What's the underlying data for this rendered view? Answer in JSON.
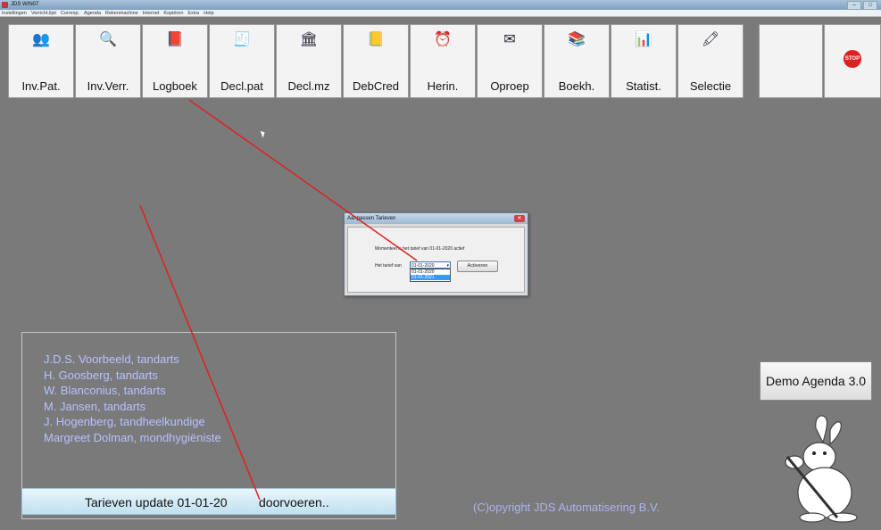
{
  "window": {
    "title": "JDS WIN07"
  },
  "menu": [
    "Instellingen",
    "Verricht.lijst",
    "Corresp.",
    "Agenda",
    "Rekenmachine",
    "Internet",
    "Kopiëren",
    "Extra",
    "Help"
  ],
  "toolbar": [
    {
      "label": "Inv.Pat.",
      "icon": "patients-icon",
      "glyph": "👥"
    },
    {
      "label": "Inv.Verr.",
      "icon": "search-icon",
      "glyph": "🔍"
    },
    {
      "label": "Logboek",
      "icon": "book-icon",
      "glyph": "📕"
    },
    {
      "label": "Decl.pat",
      "icon": "declaration-icon",
      "glyph": "🧾"
    },
    {
      "label": "Decl.mz",
      "icon": "building-icon",
      "glyph": "🏛"
    },
    {
      "label": "DebCred",
      "icon": "ledger-icon",
      "glyph": "📒"
    },
    {
      "label": "Herin.",
      "icon": "alarm-clock-icon",
      "glyph": "⏰"
    },
    {
      "label": "Oproep",
      "icon": "envelope-icon",
      "glyph": "✉"
    },
    {
      "label": "Boekh.",
      "icon": "books-icon",
      "glyph": "📚"
    },
    {
      "label": "Statist.",
      "icon": "bar-chart-icon",
      "glyph": "📊"
    },
    {
      "label": "Selectie",
      "icon": "selection-icon",
      "glyph": "🖍"
    }
  ],
  "stop": {
    "label": "STOP",
    "color": "#e02020"
  },
  "dialog": {
    "title": "Aanpassen Tarieven",
    "message": "Momenteel is het tarief van 01-01-2020 actief",
    "row_label": "Het tarief van",
    "selected": "01-01-2020",
    "options": [
      "01-01-2020",
      "01-01-2021"
    ],
    "activate_label": "Activeren"
  },
  "practitioners": [
    "J.D.S. Voorbeeld, tandarts",
    "H. Goosberg, tandarts",
    "W. Blanconius, tandarts",
    "M. Jansen, tandarts",
    "J. Hogenberg, tandheelkundige",
    "Margreet Dolman, mondhygiëniste"
  ],
  "update_bar": {
    "text1": "Tarieven update 01-01-20",
    "text2": "doorvoeren.."
  },
  "copyright": "(C)opyright JDS Automatisering B.V.",
  "demo_agenda": "Demo Agenda 3.0",
  "colors": {
    "background": "#7a7a7a",
    "practitioner_text": "#b7c2ff",
    "annotation": "#e02020"
  }
}
